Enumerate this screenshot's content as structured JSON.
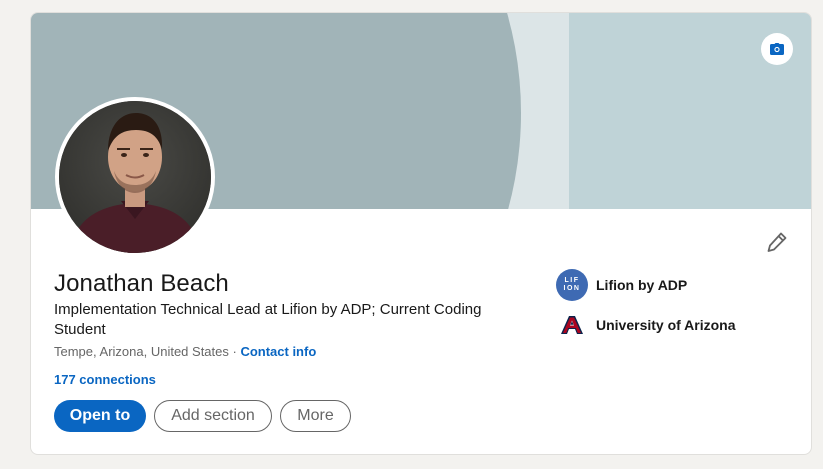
{
  "profile": {
    "name": "Jonathan Beach",
    "headline": "Implementation Technical Lead at Lifion by ADP; Current Coding Student",
    "location": "Tempe, Arizona, United States",
    "separator": " · ",
    "contact_info_label": "Contact info",
    "connections": "177 connections"
  },
  "actions": {
    "open_to_label": "Open to",
    "add_section_label": "Add section",
    "more_label": "More"
  },
  "organizations": [
    {
      "name": "Lifion by ADP",
      "logo_text": "LIF ION",
      "icon": "lifion-logo"
    },
    {
      "name": "University of Arizona",
      "logo_text": "A",
      "icon": "university-of-arizona-logo"
    }
  ],
  "icons": {
    "camera": "camera-icon",
    "edit": "pencil-icon"
  },
  "colors": {
    "accent": "#0a66c2",
    "banner_dark": "#a1b4b8",
    "banner_light": "#dce5e7",
    "banner_right": "#bfd3d7",
    "arizona_red": "#ab0520",
    "arizona_navy": "#0c234b",
    "lifion_blue": "#3e6ab3"
  }
}
